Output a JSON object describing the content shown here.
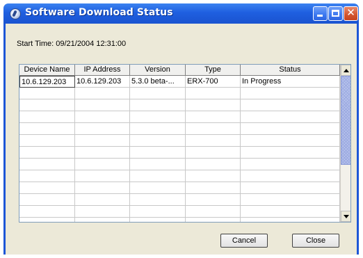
{
  "window": {
    "title": "Software Download Status",
    "icon": "software-download-icon",
    "controls": {
      "minimize": "minimize-icon",
      "maximize": "maximize-icon",
      "close": "close-icon",
      "close_glyph": "✕"
    }
  },
  "start_time": "Start Time: 09/21/2004 12:31:00",
  "table": {
    "columns": [
      "Device Name",
      "IP Address",
      "Version",
      "Type",
      "Status"
    ],
    "rows": [
      [
        "10.6.129.203",
        "10.6.129.203",
        "5.3.0 beta-...",
        "ERX-700",
        "In Progress"
      ]
    ]
  },
  "buttons": {
    "cancel": "Cancel",
    "close": "Close"
  },
  "colors": {
    "titlebar": "#1f5fe0",
    "dialog_bg": "#ece9d8",
    "scroll_thumb": "#b8c4ec"
  }
}
